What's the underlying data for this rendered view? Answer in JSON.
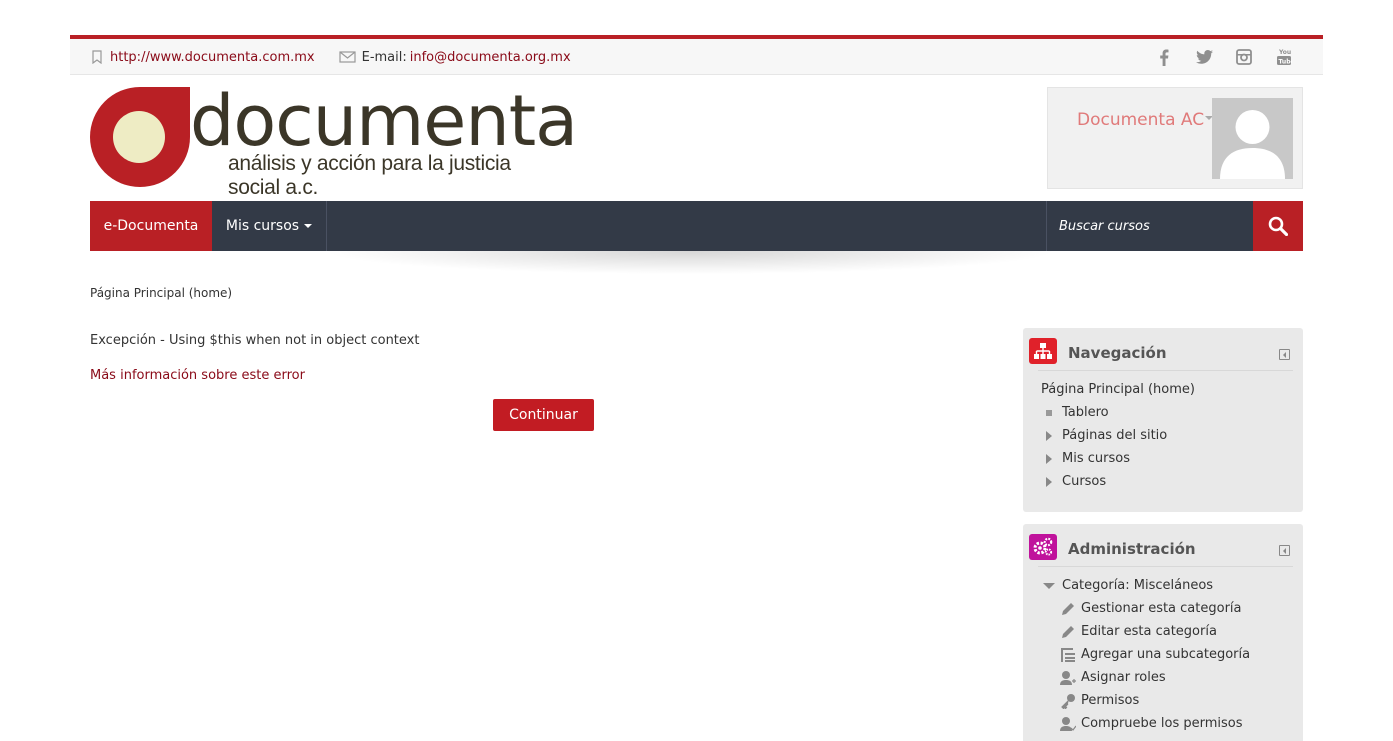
{
  "topbar": {
    "website": "http://www.documenta.com.mx",
    "email_label": "E-mail:",
    "email": "info@documenta.org.mx",
    "social": [
      "facebook-icon",
      "twitter-icon",
      "instagram-icon",
      "youtube-icon"
    ]
  },
  "header": {
    "logo_word": "documenta",
    "logo_tagline": "análisis y acción para la justicia social a.c.",
    "user_name": "Documenta AC"
  },
  "nav": {
    "home": "e-Documenta",
    "mis_cursos": "Mis cursos",
    "search_placeholder": "Buscar cursos"
  },
  "breadcrumb": "Página Principal (home)",
  "error": {
    "message": "Excepción - Using $this when not in object context",
    "more_info": "Más información sobre este error",
    "continue": "Continuar"
  },
  "navigation_block": {
    "title": "Navegación",
    "root": "Página Principal (home)",
    "items": [
      "Tablero",
      "Páginas del sitio",
      "Mis cursos",
      "Cursos"
    ]
  },
  "admin_block": {
    "title": "Administración",
    "category": "Categoría: Misceláneos",
    "items": [
      "Gestionar esta categoría",
      "Editar esta categoría",
      "Agregar una subcategoría",
      "Asignar roles",
      "Permisos",
      "Compruebe los permisos"
    ]
  },
  "colors": {
    "brand_red": "#b92025",
    "nav_dark": "#333a47",
    "admin_magenta": "#c0129c"
  }
}
